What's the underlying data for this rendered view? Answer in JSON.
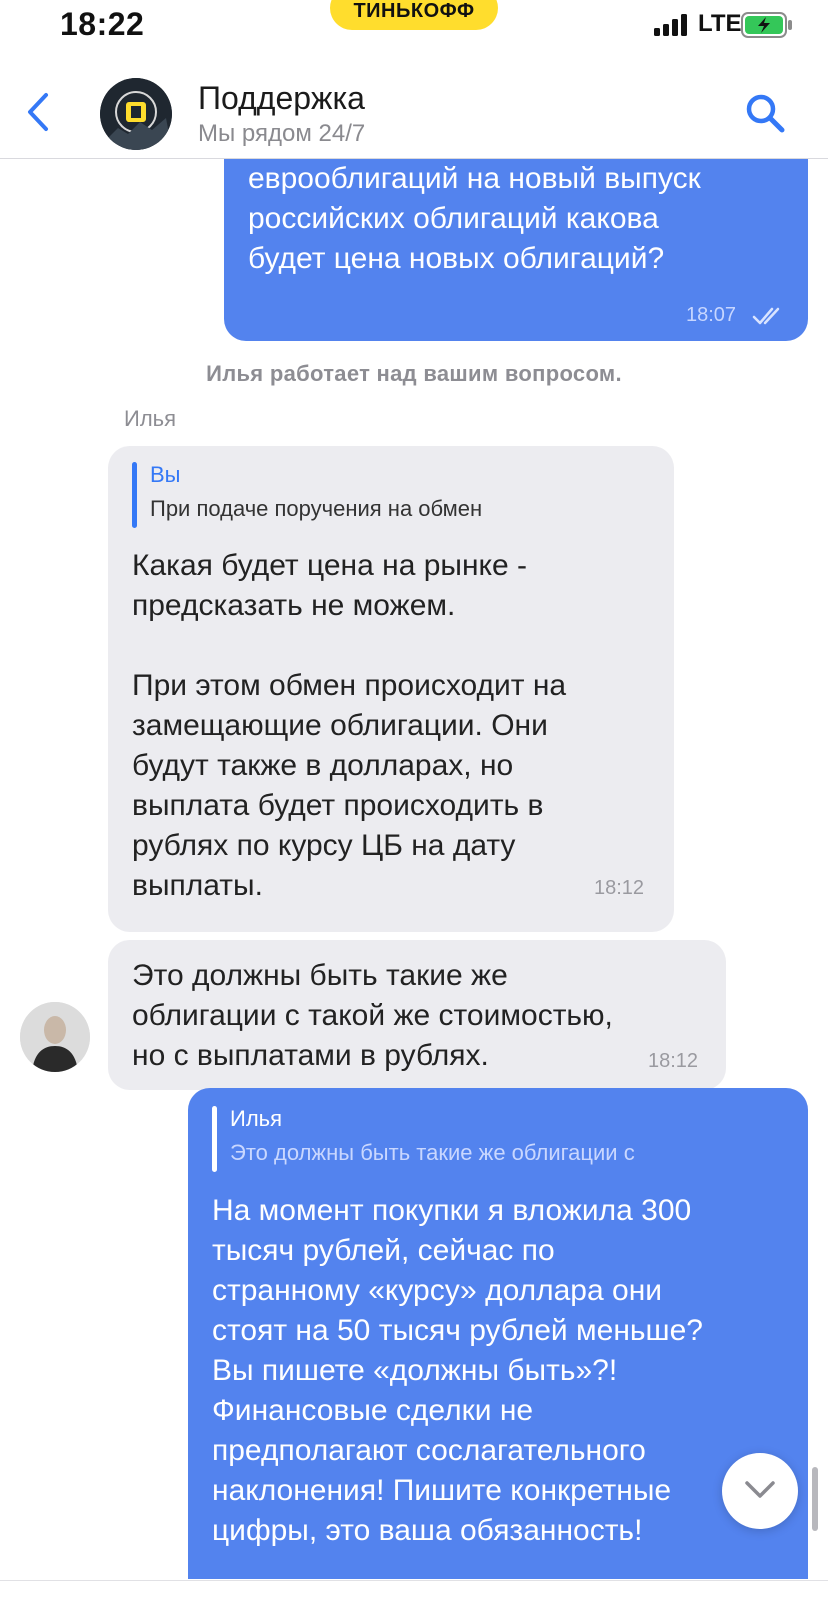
{
  "status_bar": {
    "time": "18:22",
    "bank_name": "ТИНЬКОФФ",
    "network": "LTE",
    "icons": [
      "signal-icon",
      "battery-charging-icon"
    ]
  },
  "header": {
    "title": "Поддержка",
    "subtitle": "Мы рядом 24/7",
    "icons": [
      "back-chevron-icon",
      "search-icon",
      "support-avatar"
    ]
  },
  "messages": {
    "m1": {
      "text": "При подаче поручения на обмен\nеврооблигаций на новый выпуск\nроссийских облигаций какова\nбудет цена новых облигаций?",
      "time": "18:07",
      "status_icon": "double-check-icon"
    },
    "system": "Илья работает над вашим вопросом.",
    "sender": "Илья",
    "m2": {
      "quote_name": "Вы",
      "quote_text": "При подаче поручения на обмен",
      "text": "Какая будет цена на рынке -\nпредсказать не можем.\n\nПри этом обмен происходит на\nзамещающие облигации. Они\nбудут также в долларах, но\nвыплата будет происходить в\nрублях по курсу ЦБ на дату\nвыплаты.",
      "time": "18:12"
    },
    "m3": {
      "text": "Это должны быть такие же\nоблигации с такой же стоимостью,\nно с выплатами в рублях.",
      "time": "18:12"
    },
    "m4": {
      "quote_name": "Илья",
      "quote_text": "Это должны быть такие же облигации с",
      "text": "На момент покупки я вложила 300\nтысяч рублей, сейчас по\nстранному «курсу» доллара они\nстоят на 50 тысяч рублей меньше?\nВы пишете «должны быть»?!\nФинансовые сделки не\nпредполагают сослагательного\nнаклонения! Пишите конкретные\nцифры, это ваша обязанность!"
    }
  },
  "colors": {
    "outgoing_bubble": "#5383ee",
    "incoming_bubble": "#ececf0",
    "accent": "#3478f6",
    "bank_yellow": "#ffdd2d"
  }
}
